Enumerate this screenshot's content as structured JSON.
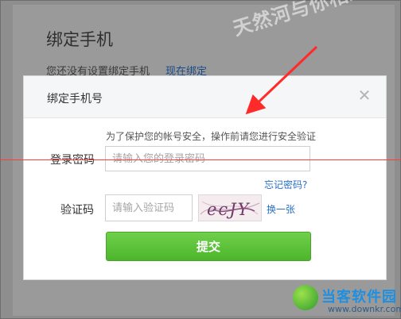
{
  "background": {
    "title": "绑定手机",
    "hint": "您还没有设置绑定手机",
    "link": "现在绑定"
  },
  "watermark": "天然河与你相约",
  "dialog": {
    "title": "绑定手机号",
    "close_icon": "close-icon",
    "notice": "为了保护您的帐号安全，操作前请您进行安全验证",
    "password_label": "登录密码",
    "password_placeholder": "请输入您的登录密码",
    "forgot_link": "忘记密码?",
    "captcha_label": "验证码",
    "captcha_placeholder": "请输入验证码",
    "captcha_text": "ecJY",
    "refresh_link": "换一张",
    "submit_label": "提交"
  },
  "logo": {
    "name": "当客软件园",
    "url": "www.downkr.com"
  },
  "colors": {
    "submit": "#54bb30",
    "link": "#2a6fc4",
    "annotation": "#ff3b3b"
  }
}
